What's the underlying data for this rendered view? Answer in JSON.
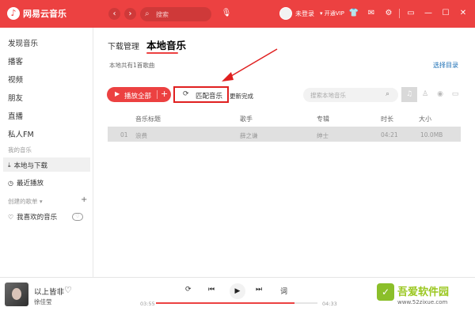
{
  "app": {
    "title": "网易云音乐",
    "brand_color": "#ec4141"
  },
  "titlebar": {
    "search_placeholder": "搜索",
    "user": "未登录",
    "vip": "▾ 开通VIP",
    "icons": [
      "back-icon",
      "forward-icon",
      "search-icon",
      "mic-icon",
      "shirt-icon",
      "mail-icon",
      "gear-icon",
      "mini-mode-icon",
      "minimize-icon",
      "maximize-icon",
      "close-icon"
    ]
  },
  "sidebar": {
    "items": [
      "发现音乐",
      "播客",
      "视频",
      "朋友",
      "直播",
      "私人FM"
    ],
    "section_mine": "我的音乐",
    "mine_items": [
      {
        "label": "本地与下载",
        "icon": "download-icon"
      },
      {
        "label": "最近播放",
        "icon": "clock-icon"
      }
    ],
    "section_playlists": "创建的歌单 ▾",
    "playlist": "我喜欢的音乐"
  },
  "main": {
    "tabs": [
      {
        "label": "下载管理",
        "active": false
      },
      {
        "label": "本地音乐",
        "active": true
      }
    ],
    "summary": "本地共有1首歌曲",
    "choose_dir": "选择目录",
    "play_all": "播放全部",
    "match": "匹配音乐",
    "update_status": "更新完成",
    "local_search_placeholder": "搜索本地音乐",
    "columns": [
      "音乐标题",
      "歌手",
      "专辑",
      "时长",
      "大小"
    ],
    "rows": [
      {
        "index": "01",
        "title": "浪费",
        "artist": "薛之谦",
        "album": "绅士",
        "duration": "04:21",
        "size": "10.0MB"
      }
    ]
  },
  "player": {
    "song": "以上皆非",
    "artist": "徐佳莹",
    "time_current": "03:55",
    "time_total": "04:33",
    "progress": 0.86
  },
  "watermark": {
    "text": "吾爱软件园",
    "url": "www.52zixue.com"
  }
}
